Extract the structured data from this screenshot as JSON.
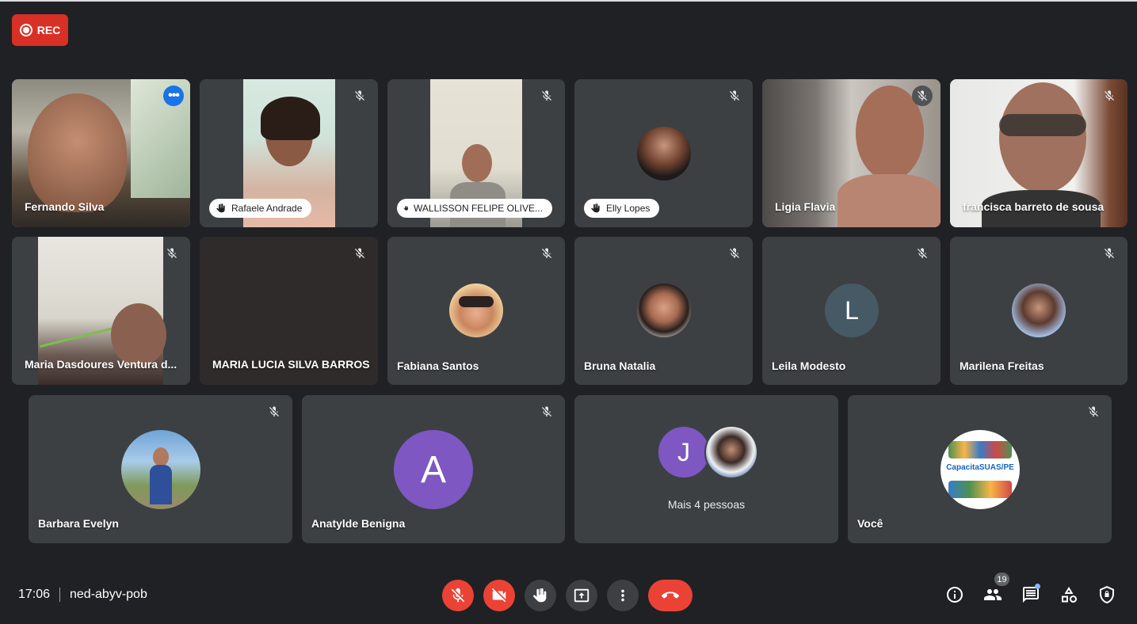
{
  "recording": {
    "label": "REC"
  },
  "participants": [
    {
      "name": "Fernando Silva"
    },
    {
      "name": "Rafaele Andrade"
    },
    {
      "name": "WALLISSON FELIPE OLIVE..."
    },
    {
      "name": "Elly Lopes"
    },
    {
      "name": "Ligia Flavia"
    },
    {
      "name": "francisca barreto de sousa"
    },
    {
      "name": "Maria Dasdoures Ventura d..."
    },
    {
      "name": "MARIA LUCIA SILVA BARROS"
    },
    {
      "name": "Fabiana Santos"
    },
    {
      "name": "Bruna Natalia"
    },
    {
      "name": "Leila Modesto",
      "initial": "L"
    },
    {
      "name": "Marilena Freitas"
    },
    {
      "name": "Barbara Evelyn"
    },
    {
      "name": "Anatylde Benigna",
      "initial": "A"
    },
    {
      "name": "Você",
      "logo_text": "CapacitaSUAS/PE"
    }
  ],
  "others": {
    "label": "Mais 4 pessoas",
    "initial": "J"
  },
  "meeting": {
    "time": "17:06",
    "code": "ned-abyv-pob"
  },
  "people_count": "19",
  "colors": {
    "background": "#202124",
    "tile": "#3c4043",
    "danger": "#ea4335",
    "accent": "#1a73e8",
    "avatar_purple": "#7e57c2",
    "avatar_slate": "#455a64"
  },
  "icons": {
    "record": "record-icon",
    "mic_off": "mic-off-icon",
    "camera_off": "camera-off-icon",
    "raise_hand": "raise-hand-icon",
    "present": "present-screen-icon",
    "more": "more-vert-icon",
    "leave": "call-end-icon",
    "info": "info-icon",
    "people": "people-icon",
    "chat": "chat-icon",
    "activities": "activities-icon",
    "host_controls": "shield-lock-icon"
  }
}
